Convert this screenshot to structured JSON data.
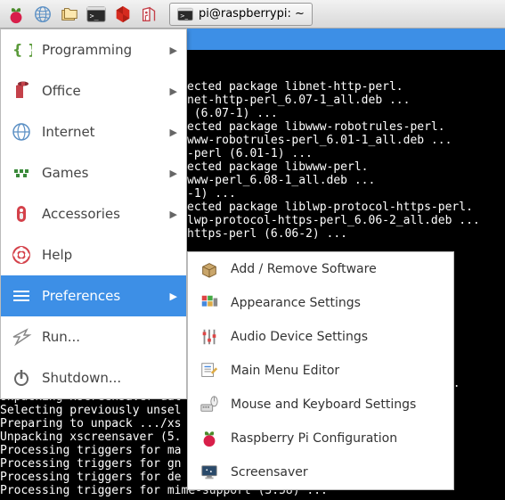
{
  "taskbar": {
    "window_title": "pi@raspberrypi: ~"
  },
  "menu": {
    "items": [
      {
        "label": "Programming",
        "has_sub": true
      },
      {
        "label": "Office",
        "has_sub": true
      },
      {
        "label": "Internet",
        "has_sub": true
      },
      {
        "label": "Games",
        "has_sub": true
      },
      {
        "label": "Accessories",
        "has_sub": true
      },
      {
        "label": "Help",
        "has_sub": false
      },
      {
        "label": "Preferences",
        "has_sub": true,
        "highlight": true
      },
      {
        "label": "Run...",
        "has_sub": false
      },
      {
        "label": "Shutdown...",
        "has_sub": false
      }
    ]
  },
  "submenu": {
    "items": [
      {
        "label": "Add / Remove Software"
      },
      {
        "label": "Appearance Settings"
      },
      {
        "label": "Audio Device Settings"
      },
      {
        "label": "Main Menu Editor"
      },
      {
        "label": "Mouse and Keyboard Settings"
      },
      {
        "label": "Raspberry Pi Configuration"
      },
      {
        "label": "Screensaver"
      }
    ]
  },
  "terminal": {
    "top_lines": "ected package libnet-http-perl.\nnet-http-perl_6.07-1_all.deb ...\n (6.07-1) ...\nected package libwww-robotrules-perl.\nwww-robotrules-perl_6.01-1_all.deb ...\n-perl (6.01-1) ...\nected package libwww-perl.\nwww-perl_6.08-1_all.deb ...\n-1) ...\nected package liblwp-protocol-https-perl.\nlwp-protocol-https-perl_6.06-2_all.deb ...\nhttps-perl (6.06-2) ...",
    "bottom_lines": "Selecting previously unsel\nPreparing to unpack .../xs                                  eb ...\nUnpacking xscreensaver-dat\nSelecting previously unsel\nPreparing to unpack .../xs\nUnpacking xscreensaver (5.\nProcessing triggers for ma\nProcessing triggers for gn\nProcessing triggers for de\nProcessing triggers for mime-support (3.58) ..."
  }
}
